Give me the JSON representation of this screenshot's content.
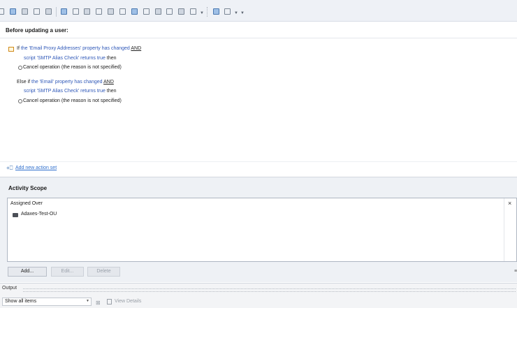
{
  "editor": {
    "title": "Before updating a user:",
    "rules": {
      "if_keyword": "If",
      "if_condition": "the 'Email Proxy Addresses' property has changed",
      "and1": "AND",
      "script1": "script 'SMTP Alias Check' returns true",
      "then1": "then",
      "action1": "Cancel operation (the reason is not specified)",
      "elseif_keyword": "Else if",
      "elseif_condition": "the 'Email' property has changed",
      "and2": "AND",
      "script2": "script 'SMTP Alias Check' returns true",
      "then2": "then",
      "action2": "Cancel operation (the reason is not specified)"
    },
    "add_action_set": "Add new action set"
  },
  "scope": {
    "title": "Activity Scope",
    "column_header": "Assigned Over",
    "close_glyph": "×",
    "items": [
      "Adaxes-Test-OU"
    ],
    "buttons": {
      "add": "Add...",
      "edit": "Edit...",
      "delete": "Delete"
    },
    "scroll_glyph": "≡"
  },
  "output": {
    "label": "Output",
    "filter_value": "Show all items",
    "view_details": "View Details"
  },
  "colors": {
    "condition_blue": "#2f58b8",
    "link_blue": "#2f6fcd",
    "toolbar_bg": "#eef1f6",
    "panel_bg": "#eef1f5"
  },
  "toolbar_icons": [
    "edit-icon",
    "users-icon",
    "list-icon",
    "monitor-icon",
    "grid-icon",
    "user-settings-icon",
    "chat-icon",
    "gear-user-icon",
    "table-icon",
    "script-icon",
    "gear-icon",
    "report-icon",
    "mail-icon",
    "group-icon",
    "gear-alt-icon",
    "document-icon",
    "copy-icon",
    "arrow-icon",
    "move-icon"
  ]
}
